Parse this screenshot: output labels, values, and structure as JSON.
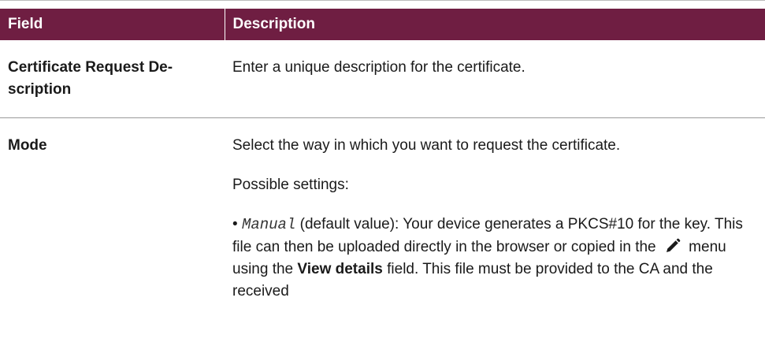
{
  "table": {
    "headers": {
      "field": "Field",
      "description": "Description"
    },
    "rows": [
      {
        "field": "Certificate Request De-scription",
        "description": "Enter a unique description for the certificate."
      },
      {
        "field": "Mode",
        "description_intro": "Select the way in which you want to request the certificate.",
        "possible_settings": "Possible settings:",
        "bullet": {
          "bullet_char": "•",
          "option": "Manual",
          "after_option": " (default value): Your device generates a PKCS#10 for the key. This file can then be uploaded directly in the browser or copied in the ",
          "icon": "pencil-icon",
          "after_icon": " menu using the ",
          "field_name": "View details",
          "tail": " field. This file must be provided to the CA and the received"
        }
      }
    ]
  },
  "colors": {
    "header_bg": "#6f1e42",
    "header_text": "#ffffff"
  }
}
